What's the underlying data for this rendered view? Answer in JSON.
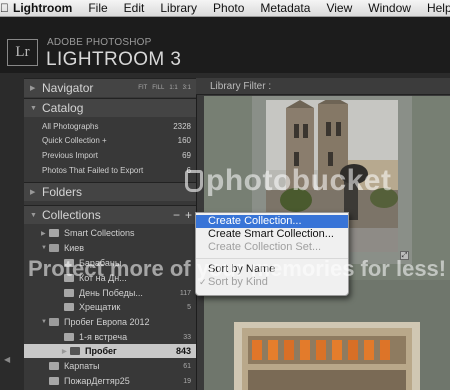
{
  "menubar": {
    "apple_icon": "apple-logo-icon",
    "items": [
      "Lightroom",
      "File",
      "Edit",
      "Library",
      "Photo",
      "Metadata",
      "View",
      "Window",
      "Help"
    ]
  },
  "identity": {
    "logo_text": "Lr",
    "adobe_text": "ADOBE PHOTOSHOP",
    "product_text": "LIGHTROOM 3"
  },
  "navigator": {
    "title": "Navigator",
    "options": [
      "FIT",
      "FILL",
      "1:1",
      "3:1"
    ]
  },
  "catalog": {
    "title": "Catalog",
    "rows": [
      {
        "label": "All Photographs",
        "count": "2328"
      },
      {
        "label": "Quick Collection +",
        "count": "160"
      },
      {
        "label": "Previous Import",
        "count": "69"
      },
      {
        "label": "Photos That Failed to Export",
        "count": "6"
      }
    ]
  },
  "folders": {
    "title": "Folders"
  },
  "collections": {
    "title": "Collections",
    "plus": "+",
    "minus": "−",
    "rows": [
      {
        "label": "Smart Collections",
        "count": ""
      },
      {
        "label": "Киев",
        "count": ""
      },
      {
        "label": "Барабаны",
        "count": ""
      },
      {
        "label": "Кот на Дн...",
        "count": ""
      },
      {
        "label": "День Победы...",
        "count": "117"
      },
      {
        "label": "Хрещатик",
        "count": "5"
      },
      {
        "label": "Пробег Европа 2012",
        "count": ""
      },
      {
        "label": "1-я встреча",
        "count": "33"
      },
      {
        "label": "Пробег",
        "count": "843"
      },
      {
        "label": "Карпаты",
        "count": "61"
      },
      {
        "label": "ПожарДегтяр25",
        "count": "19"
      }
    ]
  },
  "library_filter": "Library Filter :",
  "context_menu": {
    "items": [
      {
        "label": "Create Collection...",
        "state": "highlighted"
      },
      {
        "label": "Create Smart Collection...",
        "state": "normal"
      },
      {
        "label": "Create Collection Set...",
        "state": "disabled"
      },
      {
        "label": "Sort by Name",
        "state": "normal"
      },
      {
        "label": "Sort by Kind",
        "state": "disabled-checked"
      }
    ],
    "check_mark": "✓"
  },
  "watermark": {
    "brand": "photobucket",
    "tagline": "Protect more of your memories for less!"
  },
  "colors": {
    "menu_highlight": "#3874d7",
    "grid_background": "#777f73",
    "selected_row": "#c8c8c8"
  }
}
